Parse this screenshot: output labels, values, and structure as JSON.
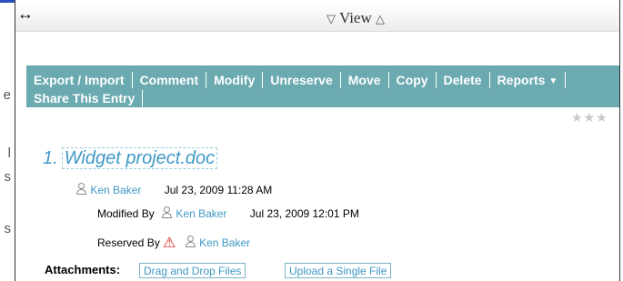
{
  "left_fragments": [
    "e",
    "l",
    "s",
    "s"
  ],
  "header": {
    "resize_glyph": "↔",
    "view_label": "View"
  },
  "action_bar": {
    "row1": [
      "Export / Import",
      "Comment",
      "Modify",
      "Unreserve",
      "Move",
      "Copy",
      "Delete",
      "Reports"
    ],
    "row2": [
      "Share This Entry"
    ]
  },
  "rating": {
    "stars": "★★★"
  },
  "entry": {
    "number": "1.",
    "title": "Widget project.doc",
    "created_by": "Ken Baker",
    "created_date": "Jul 23, 2009 11:28 AM",
    "modified_label": "Modified By",
    "modified_by": "Ken Baker",
    "modified_date": "Jul 23, 2009 12:01 PM",
    "reserved_label": "Reserved By",
    "reserved_by": "Ken Baker"
  },
  "attachments": {
    "label": "Attachments:",
    "drag_drop": "Drag and Drop Files",
    "upload": "Upload a Single File"
  },
  "colors": {
    "action_bar": "#6aaab0",
    "link": "#3f98c6"
  }
}
